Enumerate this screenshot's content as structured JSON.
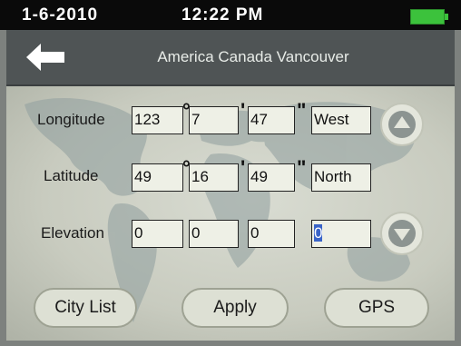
{
  "status": {
    "date": "1-6-2010",
    "time": "12:22 PM"
  },
  "header": {
    "title": "America Canada Vancouver"
  },
  "form": {
    "longitude": {
      "label": "Longitude",
      "deg": "123",
      "min": "7",
      "sec": "47",
      "dir": "West"
    },
    "latitude": {
      "label": "Latitude",
      "deg": "49",
      "min": "16",
      "sec": "49",
      "dir": "North"
    },
    "elevation": {
      "label": "Elevation",
      "f1": "0",
      "f2": "0",
      "f3": "0",
      "f4": "0"
    },
    "symbols": {
      "degree": "°",
      "minute": "'",
      "second": "\""
    }
  },
  "buttons": {
    "city_list": "City List",
    "apply": "Apply",
    "gps": "GPS"
  },
  "icons": {
    "back": "back-arrow-icon",
    "up": "scroll-up-icon",
    "down": "scroll-down-icon",
    "battery": "battery-icon"
  },
  "colors": {
    "battery": "#3cc23c",
    "selection": "#3a64c8"
  }
}
